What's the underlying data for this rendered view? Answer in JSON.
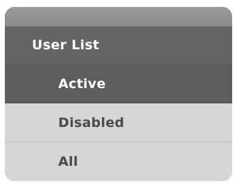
{
  "menu": {
    "title": "User List",
    "items": [
      {
        "label": "Active",
        "state": "active"
      },
      {
        "label": "Disabled",
        "state": "normal"
      },
      {
        "label": "All",
        "state": "normal"
      }
    ]
  },
  "colors": {
    "panel_background": "#8a8a8a",
    "header_background": "#646464",
    "active_background": "#5d5d5d",
    "item_background": "#d6d6d6",
    "active_text": "#ffffff",
    "item_text": "#4a4a4a"
  }
}
